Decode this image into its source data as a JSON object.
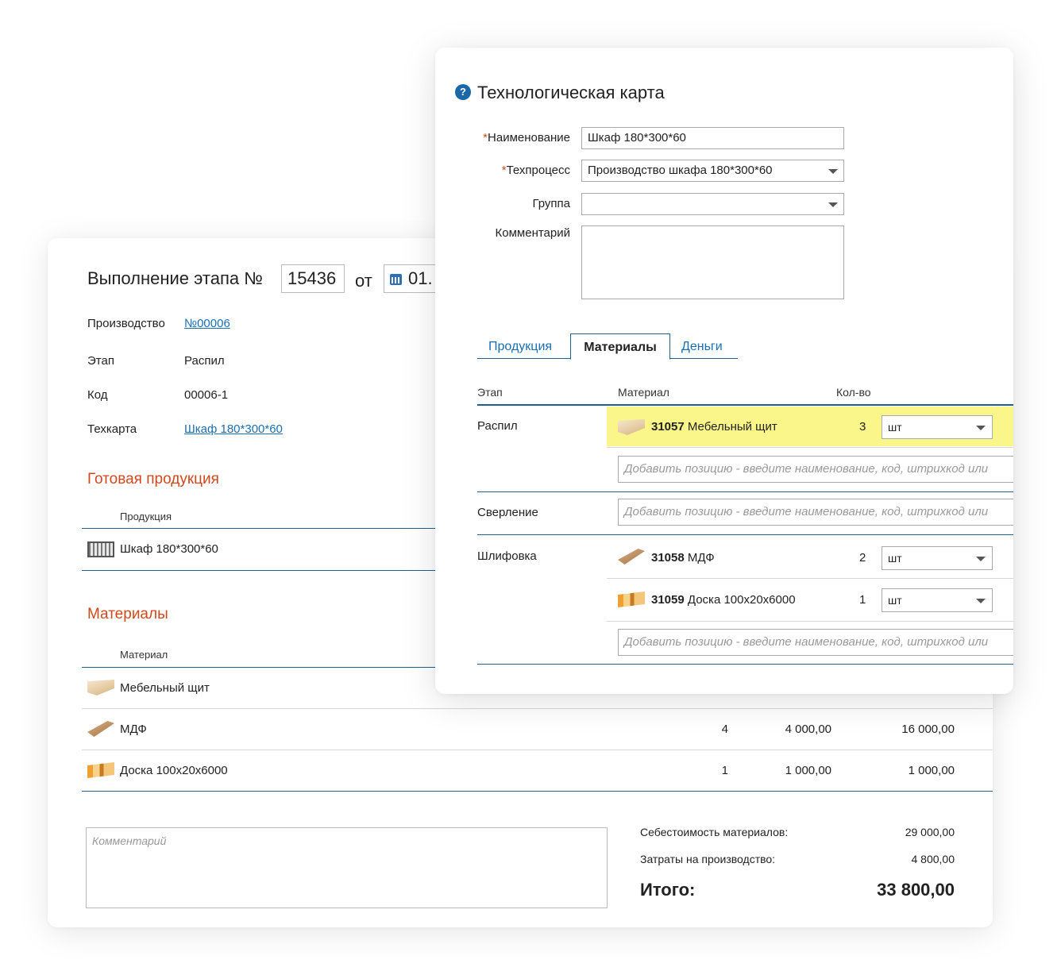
{
  "stage_form": {
    "title": "Выполнение этапа №",
    "number": "15436",
    "date_prefix": "от",
    "date_value": "01.",
    "fields": [
      {
        "label": "Производство",
        "value": "№00006",
        "is_link": true
      },
      {
        "label": "Этап",
        "value": "Распил",
        "is_link": false
      },
      {
        "label": "Код",
        "value": "00006-1",
        "is_link": false
      },
      {
        "label": "Техкарта",
        "value": "Шкаф 180*300*60",
        "is_link": true
      }
    ],
    "finished_products": {
      "title": "Готовая продукция",
      "column_header": "Продукция",
      "rows": [
        {
          "name": "Шкаф 180*300*60",
          "icon": "cabinet-icon"
        }
      ]
    },
    "materials": {
      "title": "Материалы",
      "column_header": "Материал",
      "rows": [
        {
          "name": "Мебельный щит",
          "icon": "furniture-panel-icon",
          "qty": "",
          "price": "",
          "sum": ""
        },
        {
          "name": "МДФ",
          "icon": "mdf-icon",
          "qty": "4",
          "price": "4 000,00",
          "sum": "16 000,00"
        },
        {
          "name": "Доска 100х20х6000",
          "icon": "board-icon",
          "qty": "1",
          "price": "1 000,00",
          "sum": "1 000,00"
        }
      ]
    },
    "comment_placeholder": "Комментарий",
    "summary": {
      "materials_cost_label": "Себестоимость материалов:",
      "materials_cost_value": "29 000,00",
      "production_cost_label": "Затраты на производство:",
      "production_cost_value": "4 800,00",
      "total_label": "Итого:",
      "total_value": "33 800,00"
    }
  },
  "tech_card": {
    "title": "Технологическая карта",
    "help_icon": "?",
    "required_mark": "*",
    "name_label": "Наименование",
    "name_value": "Шкаф 180*300*60",
    "process_label": "Техпроцесс",
    "process_value": "Производство шкафа 180*300*60",
    "group_label": "Группа",
    "group_value": "",
    "comment_label": "Комментарий",
    "tabs": {
      "products": "Продукция",
      "materials": "Материалы",
      "money": "Деньги",
      "active": "Материалы"
    },
    "columns": {
      "stage": "Этап",
      "material": "Материал",
      "qty": "Кол-во"
    },
    "add_placeholder": "Добавить позицию - введите наименование, код, штрихкод или",
    "stages": [
      {
        "name": "Распил",
        "items": [
          {
            "code": "31057",
            "name": "Мебельный щит",
            "qty": "3",
            "unit": "шт",
            "icon": "furniture-panel-icon",
            "highlighted": true
          }
        ]
      },
      {
        "name": "Сверление",
        "items": []
      },
      {
        "name": "Шлифовка",
        "items": [
          {
            "code": "31058",
            "name": "МДФ",
            "qty": "2",
            "unit": "шт",
            "icon": "mdf-icon",
            "highlighted": false
          },
          {
            "code": "31059",
            "name": "Доска 100х20х6000",
            "qty": "1",
            "unit": "шт",
            "icon": "board-icon",
            "highlighted": false
          }
        ]
      }
    ]
  },
  "colors": {
    "accent_blue": "#1a6fb0",
    "section_title_orange": "#d2481c",
    "highlight_yellow": "#fbf68a",
    "rule_blue": "#1b5f93"
  }
}
